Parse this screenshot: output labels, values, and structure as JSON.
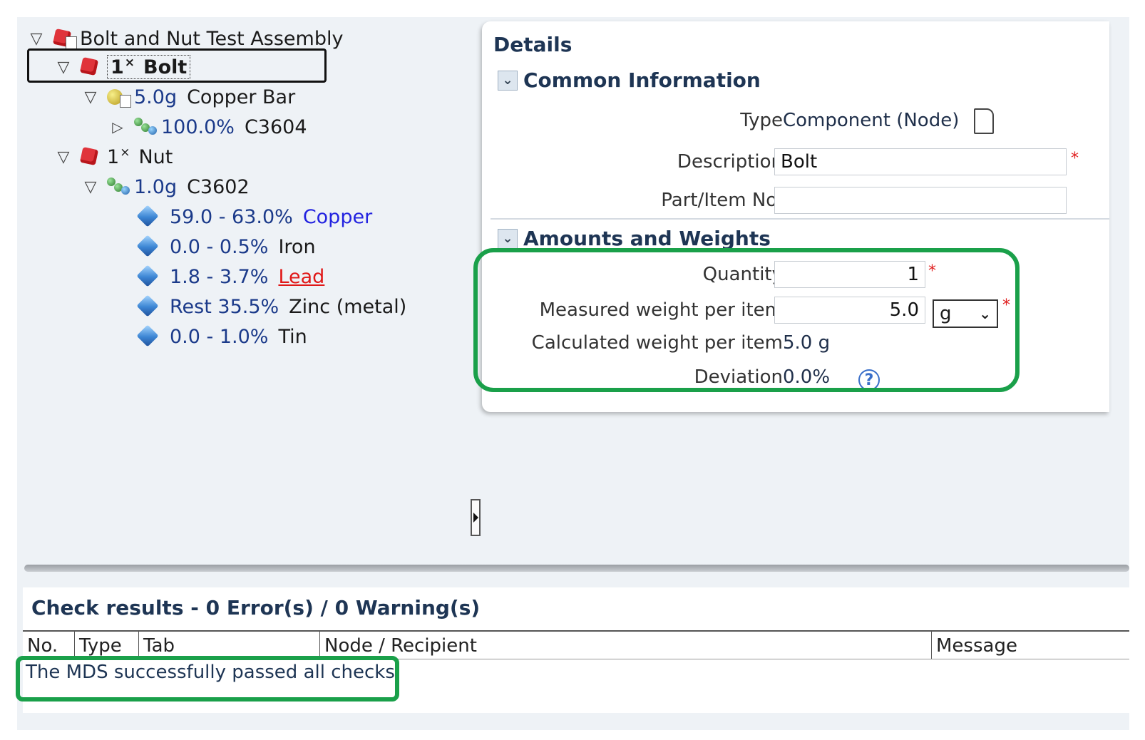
{
  "tree": {
    "root": "Bolt and Nut Test Assembly",
    "bolt": {
      "qty": "1",
      "x": "×",
      "name": "Bolt"
    },
    "copper_bar": {
      "weight": "5.0g",
      "name": "Copper Bar"
    },
    "c3604": {
      "pct": "100.0%",
      "name": "C3604"
    },
    "nut": {
      "qty": "1",
      "x": "×",
      "name": "Nut"
    },
    "c3602": {
      "weight": "1.0g",
      "name": "C3602"
    },
    "substances": [
      {
        "pct": "59.0 - 63.0%",
        "name": "Copper"
      },
      {
        "pct": "0.0 - 0.5%",
        "name": "Iron"
      },
      {
        "pct": "1.8 - 3.7%",
        "name": "Lead"
      },
      {
        "pct": "Rest  35.5%",
        "name": "Zinc (metal)"
      },
      {
        "pct": "0.0 - 1.0%",
        "name": "Tin"
      }
    ]
  },
  "details": {
    "title": "Details",
    "common_header": "Common Information",
    "type_label": "Type",
    "type_value": "Component (Node)",
    "description_label": "Description",
    "description_value": "Bolt",
    "part_label": "Part/Item No.",
    "part_value": "",
    "amounts_header": "Amounts and Weights",
    "quantity_label": "Quantity",
    "quantity_value": "1",
    "measured_label": "Measured weight per item",
    "measured_value": "5.0",
    "unit": "g",
    "calculated_label": "Calculated weight per item",
    "calculated_value": "5.0  g",
    "deviation_label": "Deviation",
    "deviation_value": "0.0%",
    "required_mark": "*"
  },
  "check": {
    "title": "Check results - 0 Error(s) / 0 Warning(s)",
    "columns": [
      "No.",
      "Type",
      "Tab",
      "Node / Recipient",
      "Message"
    ],
    "message": "The MDS successfully passed all checks."
  },
  "colors": {
    "highlight": "#1aa04a",
    "required": "#e02020",
    "link_blue": "#2323e0",
    "link_red": "#e01818"
  }
}
